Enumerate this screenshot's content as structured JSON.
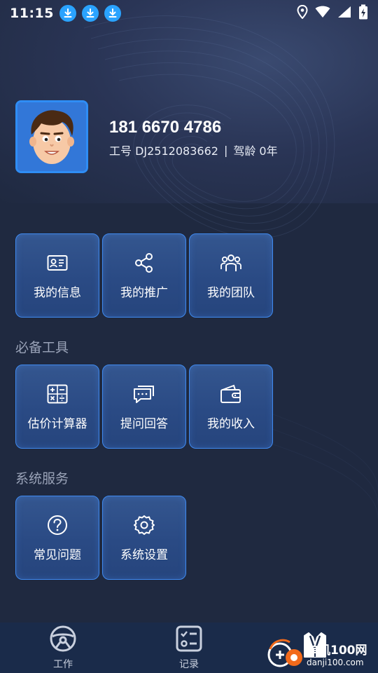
{
  "status_bar": {
    "time": "11:15",
    "download_icons": [
      "download-icon",
      "download-icon",
      "download-icon"
    ]
  },
  "profile": {
    "phone": "181 6670 4786",
    "employee_label": "工号 DJ2512083662",
    "separator": "|",
    "experience": "驾龄 0年"
  },
  "quick_menu": [
    {
      "label": "我的信息",
      "icon": "id-card-icon"
    },
    {
      "label": "我的推广",
      "icon": "share-icon"
    },
    {
      "label": "我的团队",
      "icon": "team-icon"
    }
  ],
  "tools_section": {
    "title": "必备工具",
    "items": [
      {
        "label": "估价计算器",
        "icon": "calculator-icon"
      },
      {
        "label": "提问回答",
        "icon": "chat-icon"
      },
      {
        "label": "我的收入",
        "icon": "wallet-icon"
      }
    ]
  },
  "system_section": {
    "title": "系统服务",
    "items": [
      {
        "label": "常见问题",
        "icon": "question-icon"
      },
      {
        "label": "系统设置",
        "icon": "gear-icon"
      }
    ]
  },
  "bottom_nav": [
    {
      "label": "工作",
      "icon": "steering-wheel-icon"
    },
    {
      "label": "记录",
      "icon": "checklist-icon"
    },
    {
      "label": "",
      "icon": "vest-icon"
    }
  ],
  "watermark": {
    "name": "单机100网",
    "url": "danji100.com"
  },
  "colors": {
    "background": "#1f2940",
    "tile_border": "#3f8af0",
    "accent_blue": "#2aa3ff",
    "section_title": "#9aa3b8"
  }
}
